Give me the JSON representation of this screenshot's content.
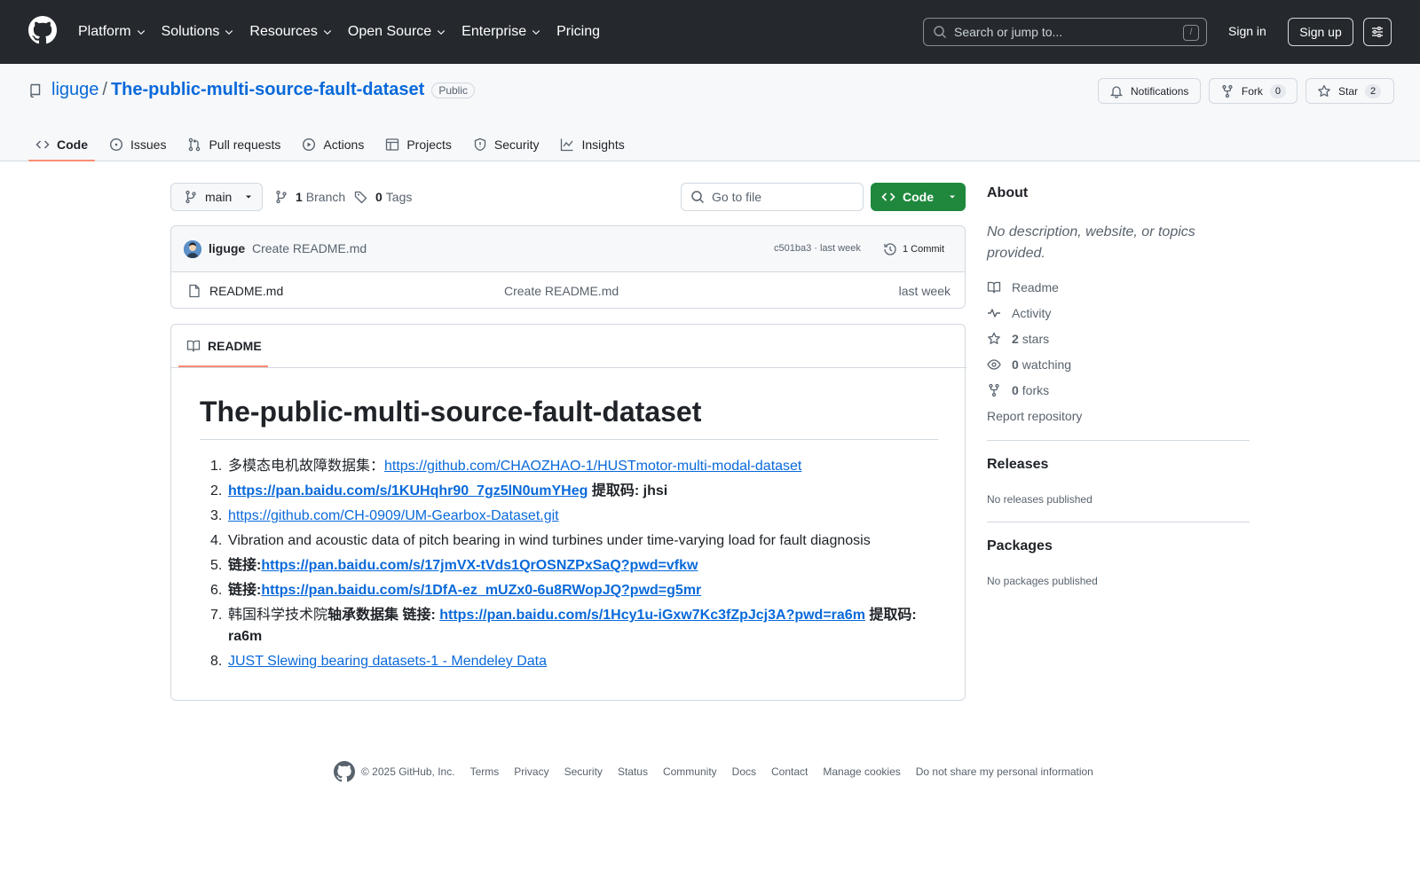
{
  "header": {
    "nav": [
      "Platform",
      "Solutions",
      "Resources",
      "Open Source",
      "Enterprise",
      "Pricing"
    ],
    "search_placeholder": "Search or jump to...",
    "search_kbd": "/",
    "signin": "Sign in",
    "signup": "Sign up"
  },
  "repo": {
    "owner": "liguge",
    "separator": "/",
    "name": "The-public-multi-source-fault-dataset",
    "visibility": "Public",
    "notifications": "Notifications",
    "fork_label": "Fork",
    "fork_count": "0",
    "star_label": "Star",
    "star_count": "2"
  },
  "tabs": [
    "Code",
    "Issues",
    "Pull requests",
    "Actions",
    "Projects",
    "Security",
    "Insights"
  ],
  "toolbar": {
    "branch": "main",
    "branch_count": "1",
    "branch_label": "Branch",
    "tag_count": "0",
    "tag_label": "Tags",
    "goto_file": "Go to file",
    "code_button": "Code"
  },
  "commit": {
    "user": "liguge",
    "message": "Create README.md",
    "hash_time": "c501ba3 · last week",
    "count": "1 Commit"
  },
  "files": [
    {
      "name": "README.md",
      "message": "Create README.md",
      "time": "last week"
    }
  ],
  "readme": {
    "tab": "README",
    "title": "The-public-multi-source-fault-dataset",
    "items": [
      {
        "num": "1.",
        "pre": "多模态电机故障数据集：",
        "link": "https://github.com/CHAOZHAO-1/HUSTmotor-multi-modal-dataset",
        "post": ""
      },
      {
        "num": "2.",
        "pre": "",
        "link": "https://pan.baidu.com/s/1KUHqhr90_7gz5lN0umYHeg",
        "post": " 提取码: jhsi"
      },
      {
        "num": "3.",
        "pre": "",
        "link": "https://github.com/CH-0909/UM-Gearbox-Dataset.git",
        "post": ""
      },
      {
        "num": "4.",
        "pre": "Vibration and acoustic data of pitch bearing in wind turbines under time-varying load for fault diagnosis",
        "link": "",
        "post": ""
      },
      {
        "num": "5.",
        "pre": "链接:",
        "link": "https://pan.baidu.com/s/17jmVX-tVds1QrOSNZPxSaQ?pwd=vfkw",
        "post": ""
      },
      {
        "num": "6.",
        "pre": "链接:",
        "link": "https://pan.baidu.com/s/1DfA-ez_mUZx0-6u8RWopJQ?pwd=g5mr",
        "post": ""
      },
      {
        "num": "7.",
        "pre_plain": "韩国科学技术院",
        "pre": "轴承数据集 链接: ",
        "link": "https://pan.baidu.com/s/1Hcy1u-iGxw7Kc3fZpJcj3A?pwd=ra6m",
        "post": " 提取码: ra6m"
      },
      {
        "num": "8.",
        "pre": "",
        "link": "JUST Slewing bearing datasets-1 - Mendeley Data",
        "post": ""
      }
    ]
  },
  "about": {
    "title": "About",
    "description": "No description, website, or topics provided.",
    "readme": "Readme",
    "activity": "Activity",
    "stars_count": "2",
    "stars_label": "stars",
    "watching_count": "0",
    "watching_label": "watching",
    "forks_count": "0",
    "forks_label": "forks",
    "report": "Report repository"
  },
  "releases": {
    "title": "Releases",
    "empty": "No releases published"
  },
  "packages": {
    "title": "Packages",
    "empty": "No packages published"
  },
  "footer": {
    "copyright": "© 2025 GitHub, Inc.",
    "links": [
      "Terms",
      "Privacy",
      "Security",
      "Status",
      "Community",
      "Docs",
      "Contact",
      "Manage cookies",
      "Do not share my personal information"
    ]
  },
  "colors": {
    "header_bg": "#25292e",
    "link": "#0969da",
    "code_button": "#1f883d",
    "active_tab_underline": "#fd8c73"
  }
}
